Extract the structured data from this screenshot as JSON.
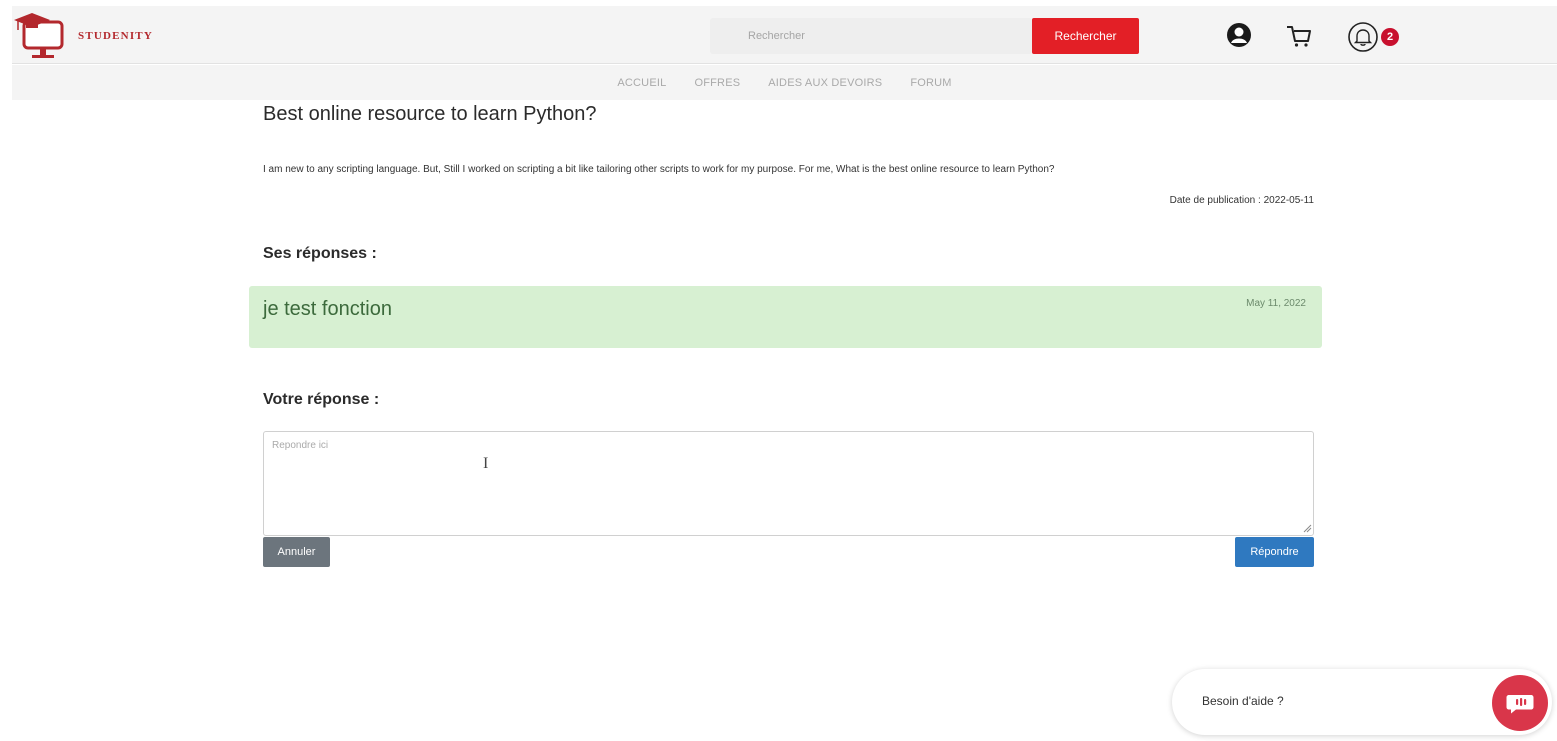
{
  "header": {
    "brand": "Studenity",
    "search_placeholder": "Rechercher",
    "search_button": "Rechercher",
    "notification_count": "2"
  },
  "nav": {
    "items": [
      "ACCUEIL",
      "OFFRES",
      "AIDES AUX DEVOIRS",
      "FORUM"
    ]
  },
  "question": {
    "title": "Best online resource to learn Python?",
    "body": "I am new to any scripting language. But, Still I worked on scripting a bit like tailoring other scripts to work for my purpose. For me, What is the best online resource to learn Python?",
    "publication_date": "Date de publication : 2022-05-11"
  },
  "answers_section": {
    "title": "Ses réponses :",
    "answers": [
      {
        "text": "je test fonction",
        "date": "May 11, 2022"
      }
    ]
  },
  "reply_section": {
    "title": "Votre réponse :",
    "placeholder": "Repondre ici",
    "cancel_label": "Annuler",
    "submit_label": "Répondre"
  },
  "help_widget": {
    "label": "Besoin d'aide ?"
  },
  "colors": {
    "brand_red": "#e31f26",
    "answer_bg": "#d7f0d2",
    "reply_blue": "#2f79c0",
    "cancel_gray": "#6c757d",
    "help_red": "#d9364a"
  }
}
